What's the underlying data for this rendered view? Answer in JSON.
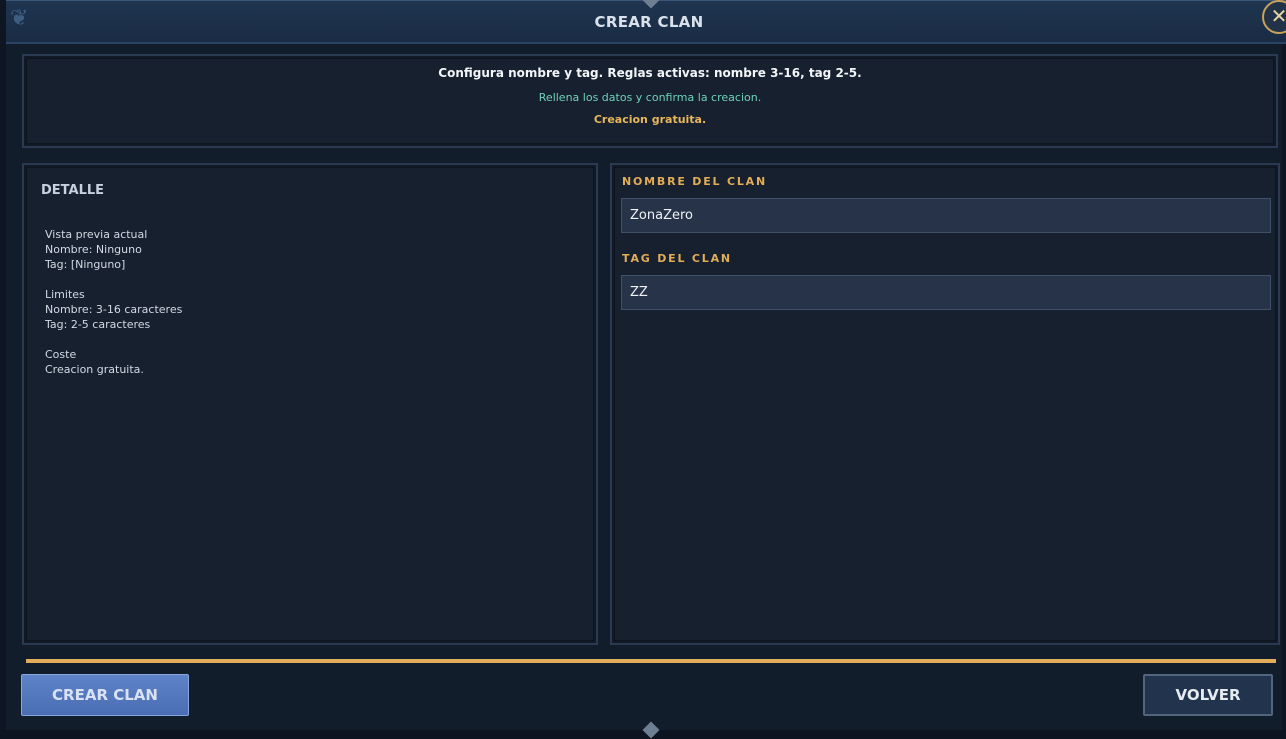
{
  "window": {
    "title": "CREAR CLAN",
    "close_symbol": "✕"
  },
  "info": {
    "main": "Configura nombre y tag. Reglas activas: nombre 3-16, tag 2-5.",
    "hint": "Rellena los datos y confirma la creacion.",
    "cost": "Creacion gratuita."
  },
  "detail": {
    "title": "DETALLE",
    "preview_heading": "Vista previa actual",
    "preview_name": "Nombre: Ninguno",
    "preview_tag": "Tag: [Ninguno]",
    "limits_heading": "Limites",
    "limits_name": "Nombre: 3-16 caracteres",
    "limits_tag": "Tag: 2-5 caracteres",
    "cost_heading": "Coste",
    "cost_value": "Creacion gratuita."
  },
  "form": {
    "name_label": "NOMBRE DEL CLAN",
    "name_value": "ZonaZero",
    "tag_label": "TAG DEL CLAN",
    "tag_value": "ZZ"
  },
  "actions": {
    "create_label": "CREAR CLAN",
    "back_label": "VOLVER"
  },
  "colors": {
    "accent_gold": "#e2ad5a",
    "hint_teal": "#6fd1b8",
    "primary_button": "#5f83c8",
    "panel_bg": "#16202f"
  }
}
